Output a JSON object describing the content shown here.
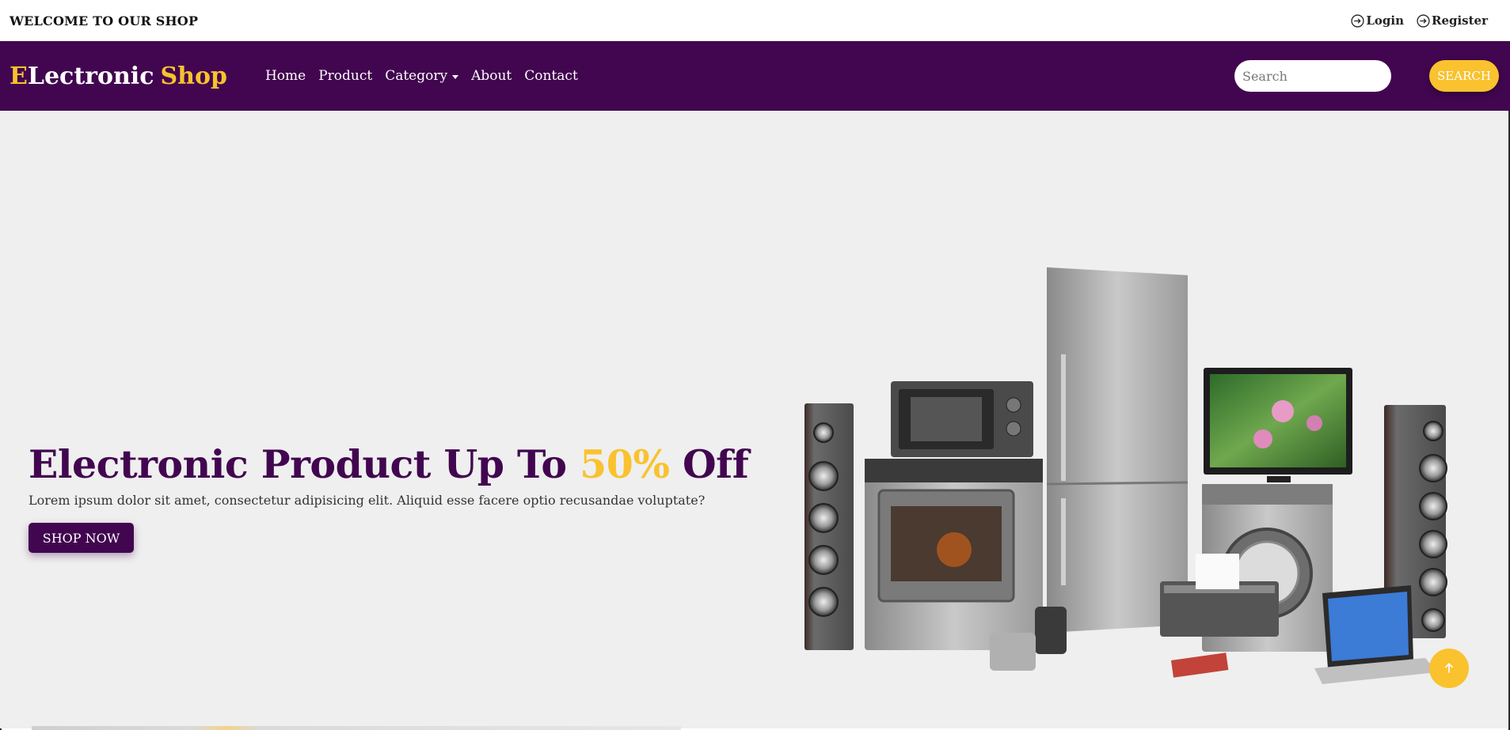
{
  "topbar": {
    "welcome": "WELCOME TO OUR SHOP",
    "login_label": "Login",
    "register_label": "Register"
  },
  "navbar": {
    "brand_e": "E",
    "brand_rest": "Lectronic",
    "brand_shop": "Shop",
    "links": [
      "Home",
      "Product",
      "Category",
      "About",
      "Contact"
    ],
    "search_placeholder": "Search",
    "search_button": "SEARCH"
  },
  "hero": {
    "title_before": "Electronic Product Up To ",
    "title_accent": "50%",
    "title_after": " Off",
    "subtitle": "Lorem ipsum dolor sit amet, consectetur adipisicing elit. Aliquid esse facere optio recusandae voluptate?",
    "cta": "SHOP NOW"
  },
  "colors": {
    "brand_purple": "#420650",
    "accent_yellow": "#f9c22e",
    "hero_bg": "#efefef"
  },
  "icons": {
    "login": "arrow-circle-right-icon",
    "register": "arrow-circle-right-icon",
    "category_dropdown": "caret-down-icon",
    "back_to_top": "arrow-up-icon"
  }
}
